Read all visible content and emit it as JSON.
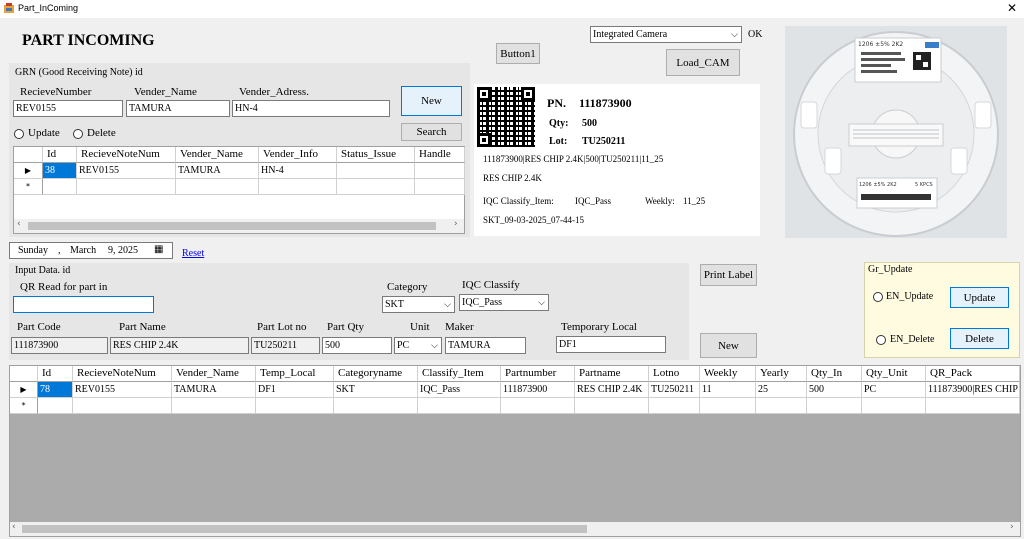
{
  "window": {
    "title": "Part_InComing",
    "close_glyph": "✕"
  },
  "heading": "PART INCOMING",
  "camera": {
    "selected": "Integrated Camera",
    "ok_label": "OK",
    "load_cam_label": "Load_CAM"
  },
  "button1_label": "Button1",
  "grn": {
    "title": "GRN (Good Receiving Note) id",
    "receive_number_label": "RecieveNumber",
    "vender_name_label": "Vender_Name",
    "vender_address_label": "Vender_Adress.",
    "receive_number_value": "REV0155",
    "vender_name_value": "TAMURA",
    "vender_address_value": "HN-4",
    "new_label": "New",
    "search_label": "Search",
    "update_radio": "Update",
    "delete_radio": "Delete",
    "grid": {
      "columns": [
        "Id",
        "RecieveNoteNum",
        "Vender_Name",
        "Vender_Info",
        "Status_Issue",
        "Handle"
      ],
      "rows": [
        [
          "38",
          "REV0155",
          "TAMURA",
          "HN-4",
          "",
          ""
        ]
      ],
      "row_indicator": "▶",
      "new_row_indicator": "*"
    }
  },
  "label": {
    "pn_key": "PN.",
    "pn_value": "111873900",
    "qty_key": "Qty:",
    "qty_value": "500",
    "lot_key": "Lot:",
    "lot_value": "TU250211",
    "qr_text": "111873900|RES CHIP 2.4K|500|TU250211|11_25",
    "part_name": "RES CHIP 2.4K",
    "iqc_key": "IQC Classify_Item:",
    "iqc_value": "IQC_Pass",
    "weekly_key": "Weekly:",
    "weekly_value": "11_25",
    "stamp": "SKT_09-03-2025_07-44-15"
  },
  "reel_photo": {
    "label_top": "1206 ±5% 2K2",
    "label_bottom": "1206 ±5% 2K2",
    "pcs": "5 KPCS"
  },
  "date_picker": {
    "day": "Sunday",
    "sep": ",",
    "month": "March",
    "date": "9, 2025",
    "reset_label": "Reset"
  },
  "input": {
    "title": "Input Data.  id",
    "qr_label": "QR Read for part in",
    "qr_value": "",
    "category_label": "Category",
    "category_value": "SKT",
    "iqc_label": "IQC Classify",
    "iqc_value": "IQC_Pass",
    "part_code_label": "Part Code",
    "part_name_label": "Part Name",
    "part_lot_label": "Part Lot no",
    "part_qty_label": "Part Qty",
    "unit_label": "Unit",
    "maker_label": "Maker",
    "temp_local_label": "Temporary Local",
    "part_code_value": "111873900",
    "part_name_value": "RES CHIP 2.4K",
    "part_lot_value": "TU250211",
    "part_qty_value": "500",
    "unit_value": "PC",
    "maker_value": "TAMURA",
    "temp_local_value": "DF1"
  },
  "print_label": "Print Label",
  "new2_label": "New",
  "gr_update": {
    "title": "Gr_Update",
    "en_update": "EN_Update",
    "en_delete": "EN_Delete",
    "update_btn": "Update",
    "delete_btn": "Delete"
  },
  "main_grid": {
    "columns": [
      "Id",
      "RecieveNoteNum",
      "Vender_Name",
      "Temp_Local",
      "Categoryname",
      "Classify_Item",
      "Partnumber",
      "Partname",
      "Lotno",
      "Weekly",
      "Yearly",
      "Qty_In",
      "Qty_Unit",
      "QR_Pack"
    ],
    "rows": [
      [
        "78",
        "REV0155",
        "TAMURA",
        "DF1",
        "SKT",
        "IQC_Pass",
        "111873900",
        "RES CHIP 2.4K",
        "TU250211",
        "11",
        "25",
        "500",
        "PC",
        "111873900|RES CHIP"
      ]
    ],
    "row_indicator": "▶",
    "new_row_indicator": "*"
  },
  "icons": {
    "scroll_left": "‹",
    "scroll_right": "›",
    "combo_arrow": "⌵",
    "calendar": "▦"
  }
}
